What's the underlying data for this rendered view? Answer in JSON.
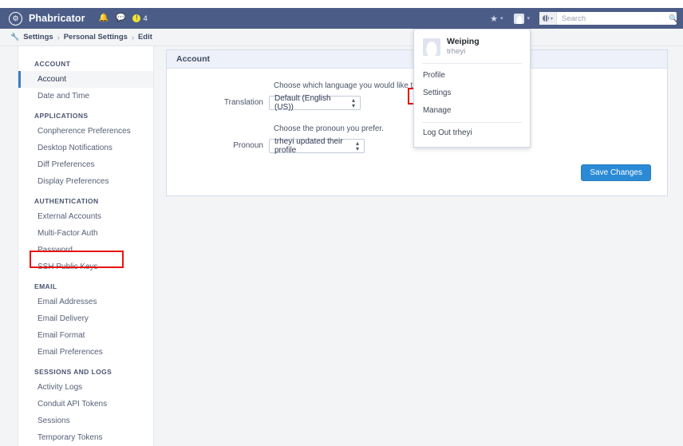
{
  "navbar": {
    "brand": "Phabricator",
    "logo_icon": "gear-in-circle-icon",
    "bell_icon": "bell-icon",
    "chat_icon": "chat-bubble-icon",
    "alert_badge_glyph": "!",
    "alert_badge_count": "4",
    "star_icon": "star-icon",
    "caret_glyph": "▾",
    "avatar_icon": "user-avatar-icon",
    "search": {
      "scope_icon": "globe-icon",
      "placeholder": "Search",
      "value": "",
      "magnifier_icon": "magnifier-icon"
    },
    "bg_color": "#4b5d87"
  },
  "breadcrumb": {
    "icon": "wrench-icon",
    "items": [
      "Settings",
      "Personal Settings",
      "Edit"
    ],
    "separator": "›"
  },
  "sidebar": {
    "groups": [
      {
        "heading": "ACCOUNT",
        "items": [
          {
            "label": "Account",
            "selected": true
          },
          {
            "label": "Date and Time",
            "selected": false
          }
        ]
      },
      {
        "heading": "APPLICATIONS",
        "items": [
          {
            "label": "Conpherence Preferences",
            "selected": false
          },
          {
            "label": "Desktop Notifications",
            "selected": false
          },
          {
            "label": "Diff Preferences",
            "selected": false
          },
          {
            "label": "Display Preferences",
            "selected": false
          }
        ]
      },
      {
        "heading": "AUTHENTICATION",
        "items": [
          {
            "label": "External Accounts",
            "selected": false
          },
          {
            "label": "Multi-Factor Auth",
            "selected": false
          },
          {
            "label": "Password",
            "selected": false
          },
          {
            "label": "SSH Public Keys",
            "selected": false,
            "highlighted": true
          }
        ]
      },
      {
        "heading": "EMAIL",
        "items": [
          {
            "label": "Email Addresses",
            "selected": false
          },
          {
            "label": "Email Delivery",
            "selected": false
          },
          {
            "label": "Email Format",
            "selected": false
          },
          {
            "label": "Email Preferences",
            "selected": false
          }
        ]
      },
      {
        "heading": "SESSIONS AND LOGS",
        "items": [
          {
            "label": "Activity Logs",
            "selected": false
          },
          {
            "label": "Conduit API Tokens",
            "selected": false
          },
          {
            "label": "Sessions",
            "selected": false
          },
          {
            "label": "Temporary Tokens",
            "selected": false
          }
        ]
      }
    ]
  },
  "panel": {
    "title": "Account",
    "translation": {
      "caption": "Choose which language you would like the Pha",
      "label": "Translation",
      "value": "Default (English (US))"
    },
    "pronoun": {
      "caption": "Choose the pronoun you prefer.",
      "label": "Pronoun",
      "value": "trheyi updated their profile"
    },
    "save_label": "Save Changes"
  },
  "user_dropdown": {
    "name": "Weiping",
    "handle": "trheyi",
    "avatar_icon": "user-avatar-icon",
    "items": [
      {
        "label": "Profile",
        "highlighted": false
      },
      {
        "label": "Settings",
        "highlighted": true
      },
      {
        "label": "Manage",
        "highlighted": false
      }
    ],
    "logout_label": "Log Out trheyi"
  },
  "highlight_color": "#e8130e"
}
